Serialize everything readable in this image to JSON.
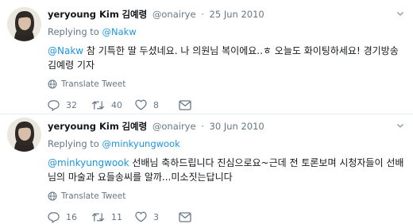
{
  "tweets": [
    {
      "name": "yeryoung Kim",
      "name_korean": "김예령",
      "handle": "@onairye",
      "dot": "·",
      "date": "25 Jun 2010",
      "replying_prefix": "Replying to",
      "replying_to": "@Nakw",
      "text_mention": "@Nakw",
      "text": " 참 기특한 딸 두셨네요. 나 의원님 복이에요..ㅎ 오늘도 화이팅하세요! 경기방송 김예령 기자",
      "translate_label": "Translate Tweet",
      "reply_count": "32",
      "retweet_count": "40",
      "like_count": "8"
    },
    {
      "name": "yeryoung Kim",
      "name_korean": "김예령",
      "handle": "@onairye",
      "dot": "·",
      "date": "30 Jun 2010",
      "replying_prefix": "Replying to",
      "replying_to": "@minkyungwook",
      "text_mention": "@minkyungwook",
      "text": " 선배님 축하드립니다 진심으로요~근데 전 토론보며 시청자들이 선배님의 마술과 요들송씨를 알까...미소짓는답니다",
      "translate_label": "Translate Tweet",
      "reply_count": "16",
      "retweet_count": "11",
      "like_count": "3"
    }
  ],
  "colors": {
    "text": "#14171a",
    "secondary": "#657786",
    "link": "#1b95e0",
    "divider": "#e6ecf0"
  },
  "icons": [
    "avatar",
    "chevron-down-icon",
    "globe-icon",
    "reply-icon",
    "retweet-icon",
    "like-icon",
    "direct-message-icon"
  ]
}
